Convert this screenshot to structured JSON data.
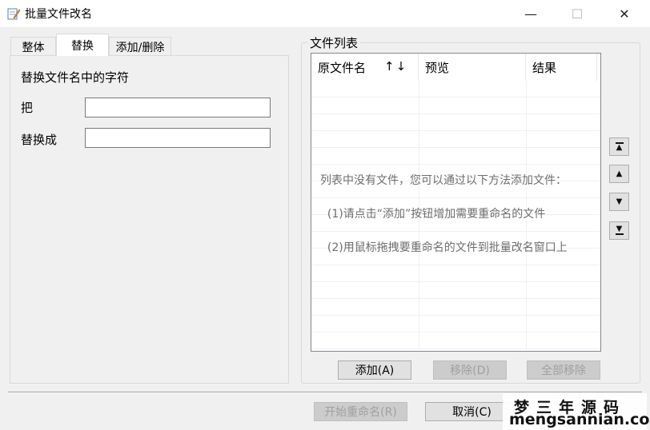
{
  "window": {
    "title": "批量文件改名",
    "minimize_glyph": "—",
    "maximize_glyph": "☐",
    "close_glyph": "✕"
  },
  "tabs": [
    {
      "label": "整体"
    },
    {
      "label": "替换"
    },
    {
      "label": "添加/删除"
    }
  ],
  "replace_panel": {
    "heading": "替换文件名中的字符",
    "from_label": "把",
    "from_value": "",
    "to_label": "替换成",
    "to_value": ""
  },
  "file_list": {
    "group_title": "文件列表",
    "columns": [
      "原文件名",
      "预览",
      "结果"
    ],
    "sort_glyph": "↑↓",
    "empty_lines": [
      "列表中没有文件，您可以通过以下方法添加文件：",
      "  (1)请点击“添加”按钮增加需要重命名的文件",
      "  (2)用鼠标拖拽要重命名的文件到批量改名窗口上"
    ],
    "add_button": "添加(A)",
    "remove_button": "移除(D)",
    "remove_all_button": "全部移除"
  },
  "move_buttons": {
    "top": "▲",
    "up": "▲",
    "down": "▼",
    "bottom": "▼"
  },
  "footer": {
    "start_button": "开始重命名(R)",
    "cancel_button": "取消(C)"
  },
  "watermark": {
    "line1": "梦三年源码",
    "line2": "mengsannian.com"
  }
}
